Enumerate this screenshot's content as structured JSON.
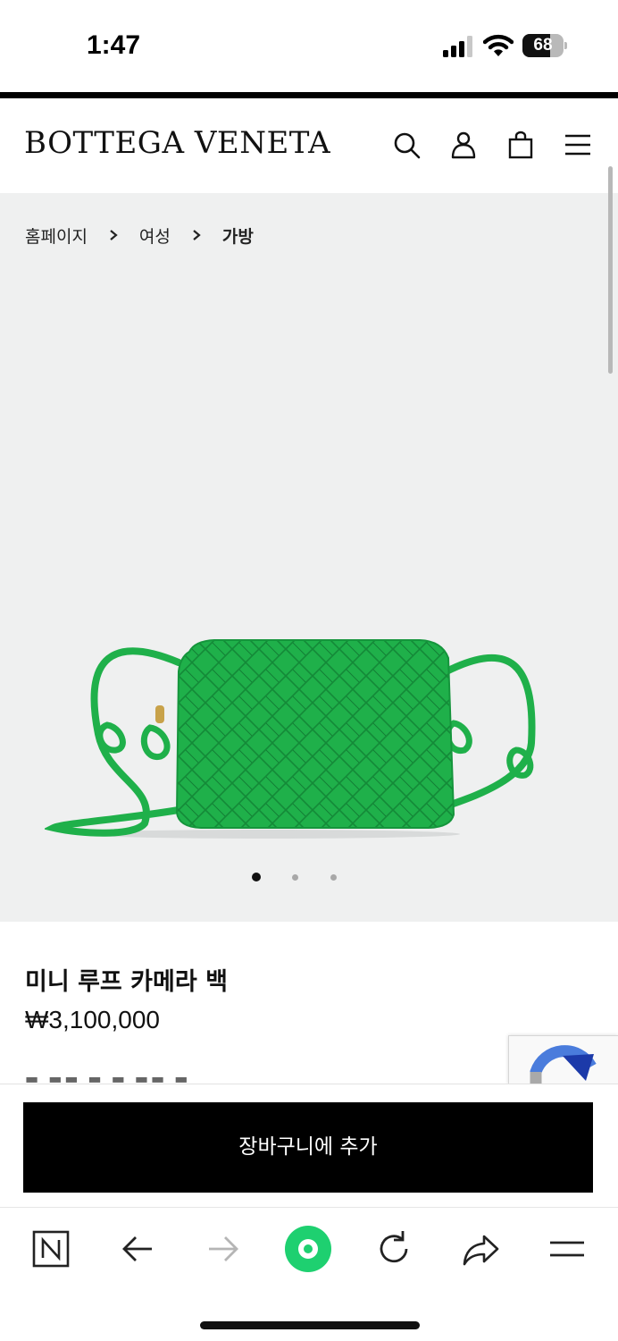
{
  "status_bar": {
    "time": "1:47",
    "battery_level": "68",
    "battery_fraction": 0.68,
    "icons": [
      "signal-icon",
      "wifi-icon",
      "battery-icon"
    ]
  },
  "header": {
    "brand": "BOTTEGA VENETA",
    "icons": [
      "search-icon",
      "account-icon",
      "shopping-bag-icon",
      "menu-icon"
    ]
  },
  "breadcrumb": {
    "items": [
      "홈페이지",
      "여성",
      "가방"
    ]
  },
  "gallery": {
    "image": "green-woven-camera-bag",
    "bag_color": "#1fb04a",
    "background": "#eff0f0",
    "active_slide": 1,
    "total_slides": 3
  },
  "product": {
    "name": "미니 루프 카메라 백",
    "price": "₩3,100,000"
  },
  "cart": {
    "add_to_cart_label": "장바구니에 추가"
  },
  "browser_toolbar": {
    "icons": [
      "naver-n-icon",
      "back-arrow-icon",
      "forward-arrow-icon",
      "green-dot-icon",
      "reload-icon",
      "share-icon",
      "menu-icon"
    ],
    "accent": "#1ed070"
  }
}
